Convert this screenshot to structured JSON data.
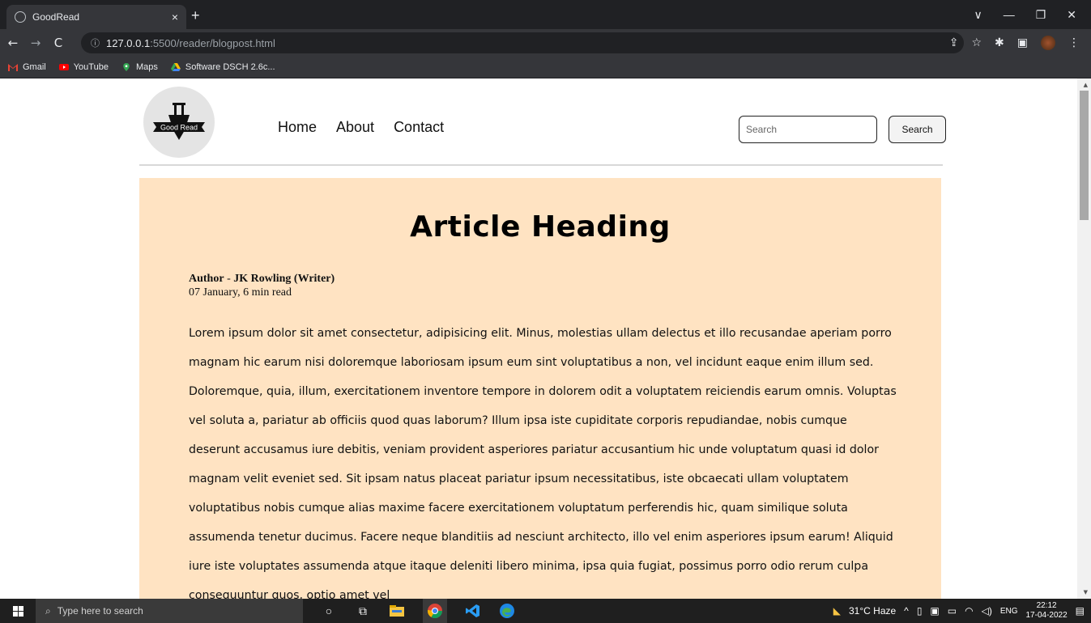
{
  "browser": {
    "tab_title": "GoodRead",
    "tab_close": "×",
    "new_tab": "+",
    "window_controls": [
      "∨",
      "—",
      "❐",
      "✕"
    ],
    "url_host": "127.0.0.1",
    "url_path": ":5500/reader/blogpost.html",
    "nav": {
      "back": "←",
      "forward": "→",
      "reload": "C"
    },
    "bookmarks": [
      {
        "label": "Gmail",
        "icon": "gmail-icon",
        "color": "#ea4335"
      },
      {
        "label": "YouTube",
        "icon": "youtube-icon",
        "color": "#ff0000"
      },
      {
        "label": "Maps",
        "icon": "maps-icon",
        "color": "#34a853"
      },
      {
        "label": "Software DSCH 2.6c...",
        "icon": "drive-icon",
        "color": "#fbbc04"
      }
    ]
  },
  "site": {
    "logo_text": "Good Read",
    "nav": [
      "Home",
      "About",
      "Contact"
    ],
    "search_placeholder": "Search",
    "search_button": "Search"
  },
  "article": {
    "heading": "Article Heading",
    "author_label": "Author",
    "author_sep": " - ",
    "author_name": "JK Rowling (Writer)",
    "date_line": "07 January, 6 min read",
    "body": "Lorem ipsum dolor sit amet consectetur, adipisicing elit. Minus, molestias ullam delectus et illo recusandae aperiam porro magnam hic earum nisi doloremque laboriosam ipsum eum sint voluptatibus a non, vel incidunt eaque enim illum sed. Doloremque, quia, illum, exercitationem inventore tempore in dolorem odit a voluptatem reiciendis earum omnis. Voluptas vel soluta a, pariatur ab officiis quod quas laborum? Illum ipsa iste cupiditate corporis repudiandae, nobis cumque deserunt accusamus iure debitis, veniam provident asperiores pariatur accusantium hic unde voluptatum quasi id dolor magnam velit eveniet sed. Sit ipsam natus placeat pariatur ipsum necessitatibus, iste obcaecati ullam voluptatem voluptatibus nobis cumque alias maxime facere exercitationem voluptatum perferendis hic, quam similique soluta assumenda tenetur ducimus. Facere neque blanditiis ad nesciunt architecto, illo vel enim asperiores ipsum earum! Aliquid iure iste voluptates assumenda atque itaque deleniti libero minima, ipsa quia fugiat, possimus porro odio rerum culpa consequuntur quos, optio amet vel"
  },
  "taskbar": {
    "search_placeholder": "Type here to search",
    "weather": "31°C Haze",
    "language": "ENG",
    "time": "22:12",
    "date": "17-04-2022"
  },
  "colors": {
    "article_bg": "#ffe3c2",
    "chrome_dark": "#202124",
    "chrome_mid": "#35363a"
  }
}
